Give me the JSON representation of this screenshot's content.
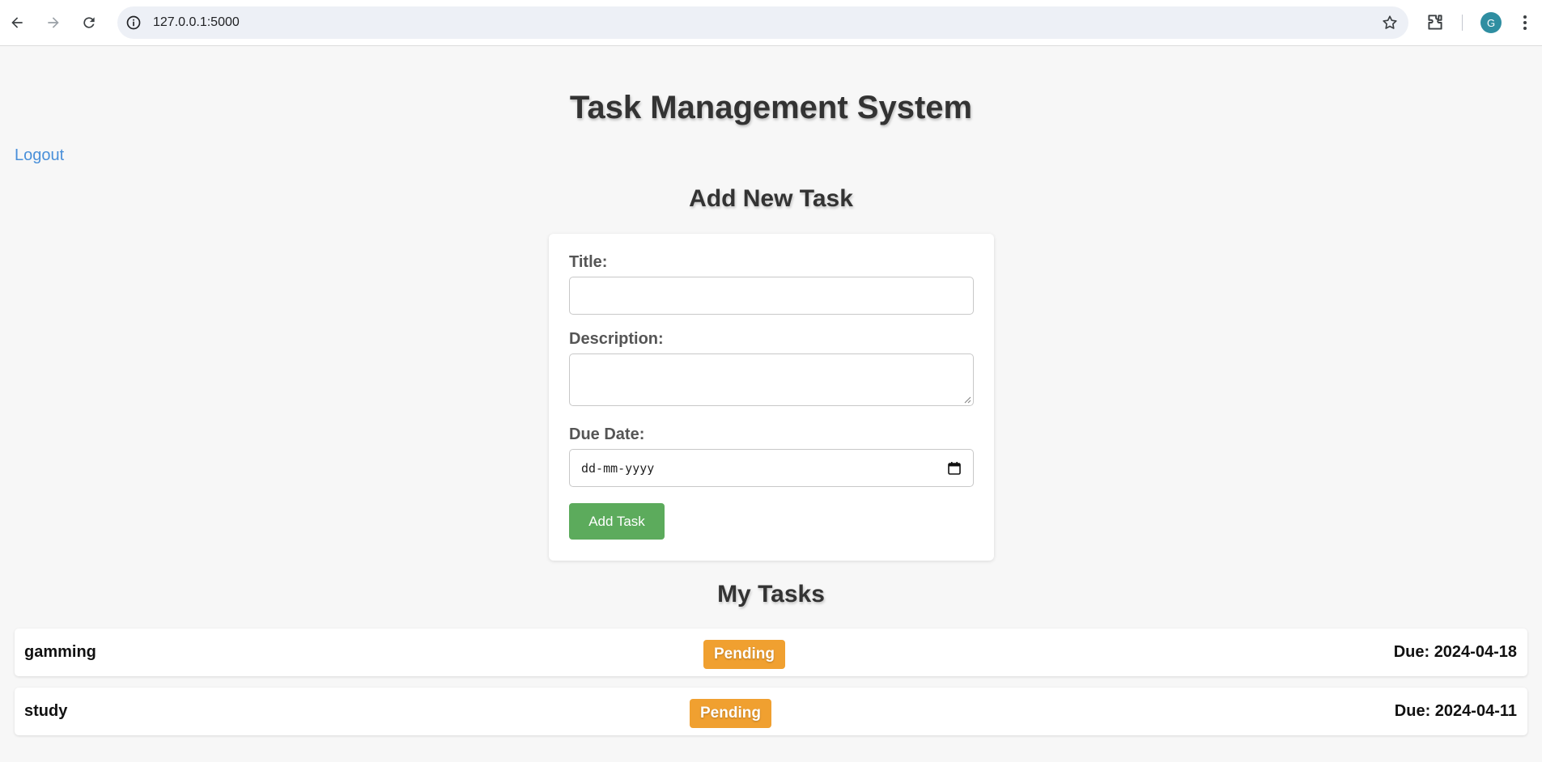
{
  "browser": {
    "url": "127.0.0.1:5000",
    "profile_initial": "G"
  },
  "page": {
    "title": "Task Management System",
    "logout_label": "Logout"
  },
  "add_form": {
    "heading": "Add New Task",
    "title_label": "Title:",
    "title_value": "",
    "description_label": "Description:",
    "description_value": "",
    "due_date_label": "Due Date:",
    "due_date_placeholder": "dd-mm-yyyy",
    "submit_label": "Add Task"
  },
  "tasks_section": {
    "heading": "My Tasks",
    "tasks": [
      {
        "title": "gamming",
        "status": "Pending",
        "due": "Due: 2024-04-18"
      },
      {
        "title": "study",
        "status": "Pending",
        "due": "Due: 2024-04-11"
      }
    ]
  },
  "colors": {
    "accent_green": "#5cab5c",
    "status_pending": "#f0a030",
    "link_blue": "#4a90d9"
  }
}
